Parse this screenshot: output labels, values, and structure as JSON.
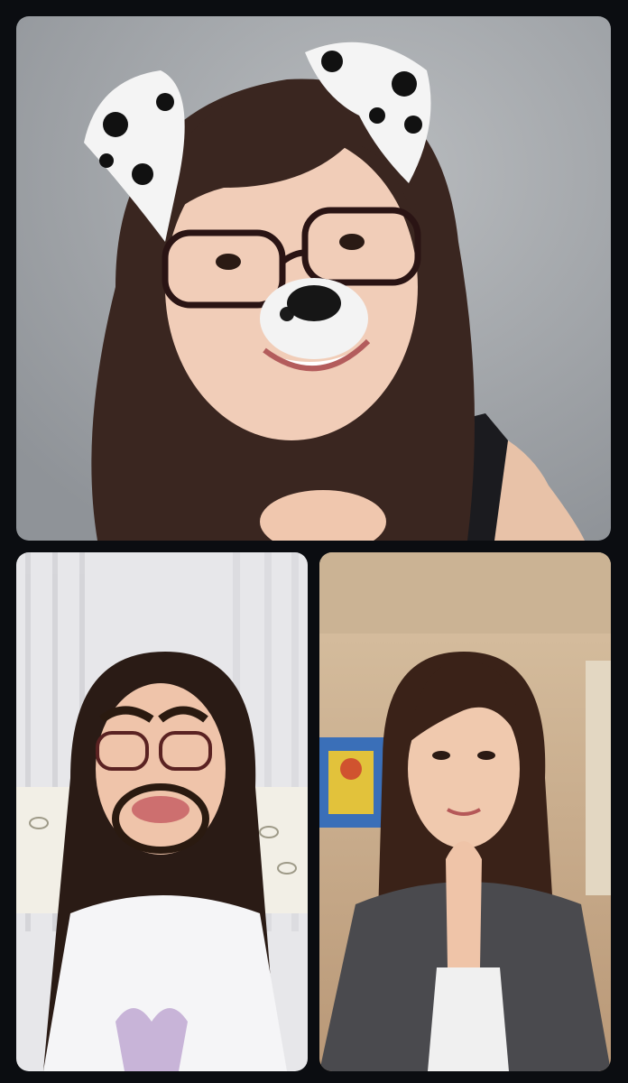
{
  "live_call": {
    "participants": [
      {
        "slot": "top",
        "filter": "dalmatian-dog-ears-icon",
        "background": "#a6a9ad"
      },
      {
        "slot": "bottom-left",
        "filter": "drawn-beard-eyebrows-icon",
        "background": "#e6e6e8"
      },
      {
        "slot": "bottom-right",
        "filter": "none",
        "background": "#d9c3a3"
      }
    ]
  }
}
